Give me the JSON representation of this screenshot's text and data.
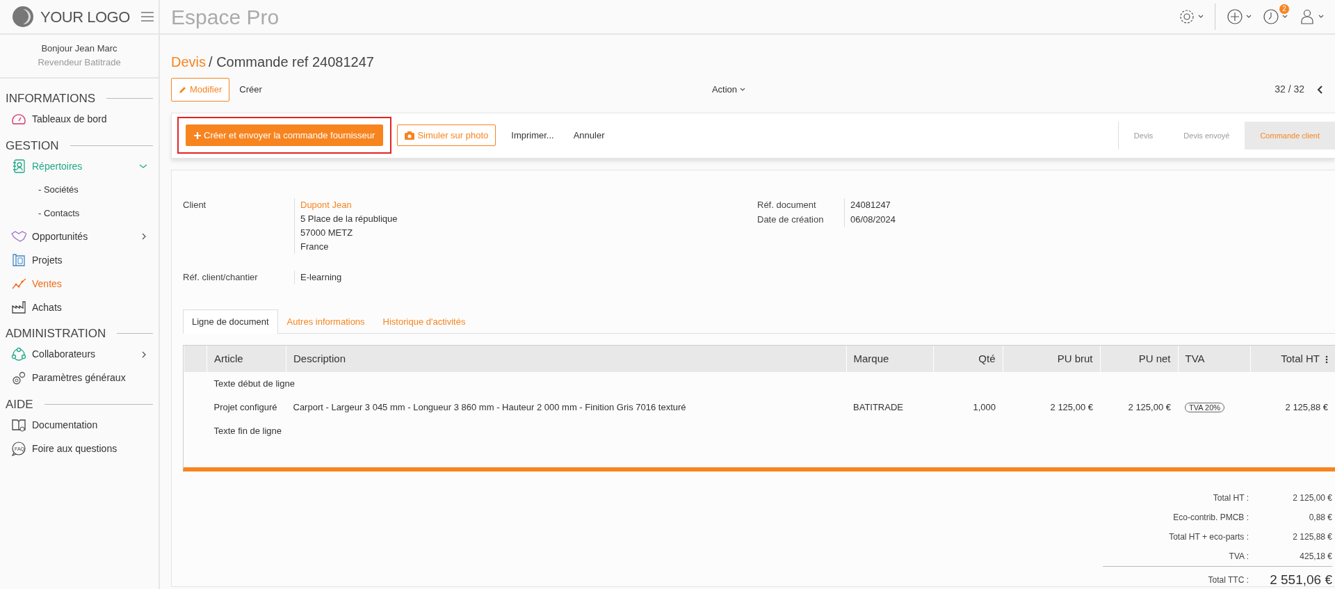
{
  "logo": {
    "text": "YOUR LOGO"
  },
  "app_title": "Espace Pro",
  "topbar": {
    "notification_count": "2"
  },
  "user": {
    "greeting": "Bonjour Jean Marc",
    "role": "Revendeur Batitrade"
  },
  "sidebar": {
    "sections": [
      {
        "title": "INFORMATIONS",
        "items": [
          {
            "label": "Tableaux de bord",
            "selected": false
          }
        ]
      },
      {
        "title": "GESTION",
        "items": [
          {
            "label": "Répertoires",
            "selected": false,
            "expanded": true,
            "children": [
              {
                "label": "- Sociétés"
              },
              {
                "label": "- Contacts"
              }
            ]
          },
          {
            "label": "Opportunités",
            "selected": false,
            "expanded": false
          },
          {
            "label": "Projets",
            "selected": false
          },
          {
            "label": "Ventes",
            "selected": true
          },
          {
            "label": "Achats",
            "selected": false
          }
        ]
      },
      {
        "title": "ADMINISTRATION",
        "items": [
          {
            "label": "Collaborateurs",
            "selected": false,
            "expanded": false
          },
          {
            "label": "Paramètres généraux",
            "selected": false
          }
        ]
      },
      {
        "title": "AIDE",
        "items": [
          {
            "label": "Documentation",
            "selected": false
          },
          {
            "label": "Foire aux questions",
            "selected": false,
            "icon_label": "FAQ"
          }
        ]
      }
    ]
  },
  "breadcrumb": {
    "parent": "Devis",
    "current": "/ Commande ref 24081247"
  },
  "edit_button": "Modifier",
  "create_link": "Créer",
  "action_menu": "Action",
  "pager": "32 / 32",
  "toolbar": [
    {
      "kind": "primary",
      "label": "Créer et envoyer la commande fournisseur",
      "highlighted": true
    },
    {
      "kind": "outline",
      "label": "Simuler sur photo"
    },
    {
      "kind": "link",
      "label": "Imprimer..."
    },
    {
      "kind": "link",
      "label": "Annuler"
    }
  ],
  "steps": [
    {
      "label": "Devis",
      "selected": false
    },
    {
      "label": "Devis envoyé",
      "selected": false
    },
    {
      "label": "Commande client",
      "selected": true
    }
  ],
  "client": {
    "label": "Client",
    "name": "Dupont Jean",
    "address": [
      "5 Place de la république",
      "57000 METZ",
      "France"
    ]
  },
  "ref_chantier": {
    "label": "Réf. client/chantier",
    "value": "E-learning"
  },
  "doc_fields": [
    {
      "label": "Réf. document",
      "value": "24081247"
    },
    {
      "label": "Date de création",
      "value": "06/08/2024"
    }
  ],
  "tabs": [
    {
      "label": "Ligne de document",
      "selected": true
    },
    {
      "label": "Autres informations",
      "selected": false
    },
    {
      "label": "Historique d'activités",
      "selected": false
    }
  ],
  "table": {
    "columns": [
      "Article",
      "Description",
      "Marque",
      "Qté",
      "PU brut",
      "PU net",
      "TVA",
      "Total HT"
    ],
    "rows": [
      {
        "kind": "text",
        "article": "Texte début de ligne"
      },
      {
        "kind": "item",
        "article": "Projet configuré",
        "description": "Carport - Largeur 3 045 mm - Longueur 3 860 mm - Hauteur 2 000 mm - Finition Gris 7016 texturé",
        "marque": "BATITRADE",
        "qte": "1,000",
        "pu_brut": "2 125,00 €",
        "pu_net": "2 125,00 €",
        "tva": "TVA 20%",
        "total_ht": "2 125,88 €"
      },
      {
        "kind": "text",
        "article": "Texte fin de ligne"
      }
    ]
  },
  "totals": [
    {
      "label": "Total HT :",
      "value": "2 125,00 €"
    },
    {
      "label": "Eco-contrib. PMCB :",
      "value": "0,88 €"
    },
    {
      "label": "Total HT + eco-parts :",
      "value": "2 125,88 €"
    },
    {
      "label": "TVA :",
      "value": "425,18 €"
    }
  ],
  "total_ttc": {
    "label": "Total TTC :",
    "value": "2 551,06 €"
  }
}
